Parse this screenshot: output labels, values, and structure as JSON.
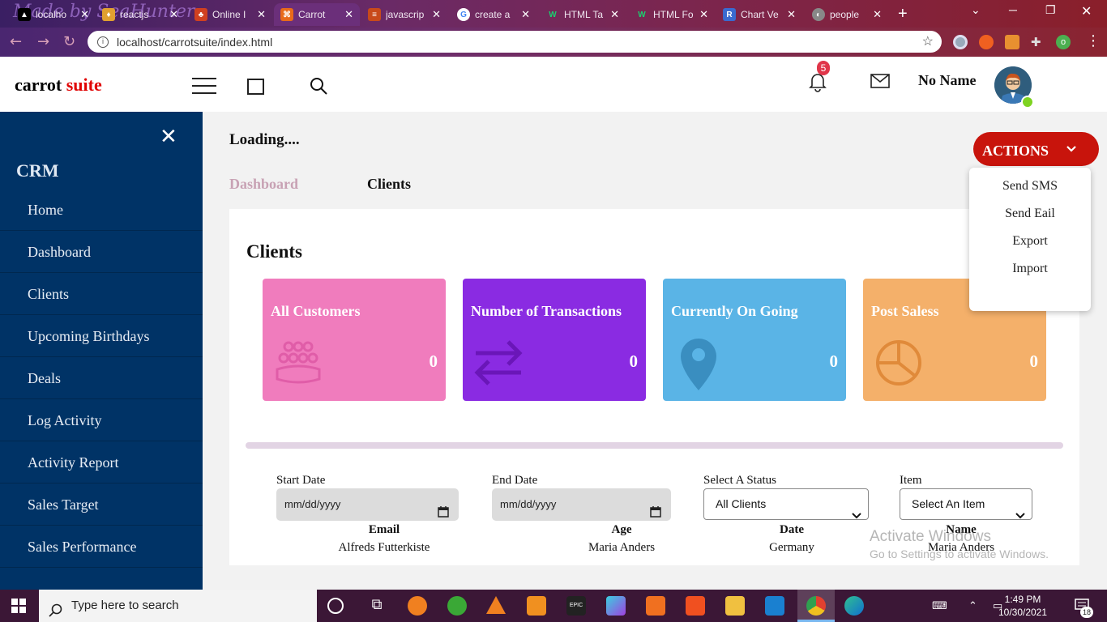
{
  "browser": {
    "tabs": [
      {
        "title": "localho",
        "favicon_color": "#000000",
        "favicon_glyph": "▲"
      },
      {
        "title": "reactjs",
        "favicon_color": "#e0a030",
        "favicon_glyph": "♦"
      },
      {
        "title": "Online I",
        "favicon_color": "#d04020",
        "favicon_glyph": "♣"
      },
      {
        "title": "Carrot",
        "favicon_color": "#e86a1a",
        "favicon_glyph": "⌘"
      },
      {
        "title": "javascrip",
        "favicon_color": "#c84a1a",
        "favicon_glyph": "≡"
      },
      {
        "title": "create a",
        "favicon_color": "#4285f4",
        "favicon_glyph": "G"
      },
      {
        "title": "HTML Ta",
        "favicon_color": "#1aa060",
        "favicon_glyph": "W"
      },
      {
        "title": "HTML Fo",
        "favicon_color": "#1aa060",
        "favicon_glyph": "W"
      },
      {
        "title": "Chart Ve",
        "favicon_color": "#3a6ad0",
        "favicon_glyph": "R"
      },
      {
        "title": "people",
        "favicon_color": "#888888",
        "favicon_glyph": "◐"
      }
    ],
    "watermark_text": "Made by SeaHunter",
    "url": "localhost/carrotsuite/index.html"
  },
  "header": {
    "logo_part1": "carrot",
    "logo_part2": "suite",
    "notification_count": "5",
    "username": "No Name"
  },
  "sidebar": {
    "title": "CRM",
    "items": [
      {
        "label": "Home"
      },
      {
        "label": "Dashboard"
      },
      {
        "label": "Clients"
      },
      {
        "label": "Upcoming Birthdays"
      },
      {
        "label": "Deals"
      },
      {
        "label": "Log Activity"
      },
      {
        "label": "Activity Report"
      },
      {
        "label": "Sales Target"
      },
      {
        "label": "Sales Performance"
      }
    ]
  },
  "main": {
    "loading_text": "Loading....",
    "breadcrumb": {
      "dashboard": "Dashboard",
      "clients": "Clients"
    },
    "actions": {
      "label": "ACTIONS",
      "menu": [
        "Send SMS",
        "Send Eail",
        "Export",
        "Import"
      ]
    },
    "panel_title": "Clients",
    "cards": [
      {
        "label": "All Customers",
        "value": "0",
        "color": "#f07cbd",
        "icon": "people-group-icon"
      },
      {
        "label": "Number of Transactions",
        "value": "0",
        "color": "#8a2be2",
        "icon": "transfer-arrows-icon"
      },
      {
        "label": "Currently On Going",
        "value": "0",
        "color": "#5ab4e6",
        "icon": "location-pin-icon"
      },
      {
        "label": "Post Saless",
        "value": "0",
        "color": "#f4b06a",
        "icon": "pie-chart-icon"
      }
    ],
    "filters": {
      "start_date_label": "Start Date",
      "start_date_value": "mm/dd/yyyy",
      "end_date_label": "End Date",
      "end_date_value": "mm/dd/yyyy",
      "status_label": "Select A Status",
      "status_value": "All Clients",
      "item_label": "Item",
      "item_value": "Select An Item"
    },
    "table": {
      "headers": [
        "Email",
        "Age",
        "Date",
        "Name"
      ],
      "rows": [
        [
          "Alfreds Futterkiste",
          "Maria Anders",
          "Germany",
          "Maria Anders"
        ]
      ]
    },
    "windows_watermark": {
      "line1": "Activate Windows",
      "line2": "Go to Settings to activate Windows."
    }
  },
  "taskbar": {
    "search_placeholder": "Type here to search",
    "time": "1:49 PM",
    "date": "10/30/2021",
    "notification_count": "18"
  },
  "colors": {
    "sidebar_bg": "#003366",
    "actions_bg": "#c8140c",
    "logo_accent": "#e00000"
  }
}
